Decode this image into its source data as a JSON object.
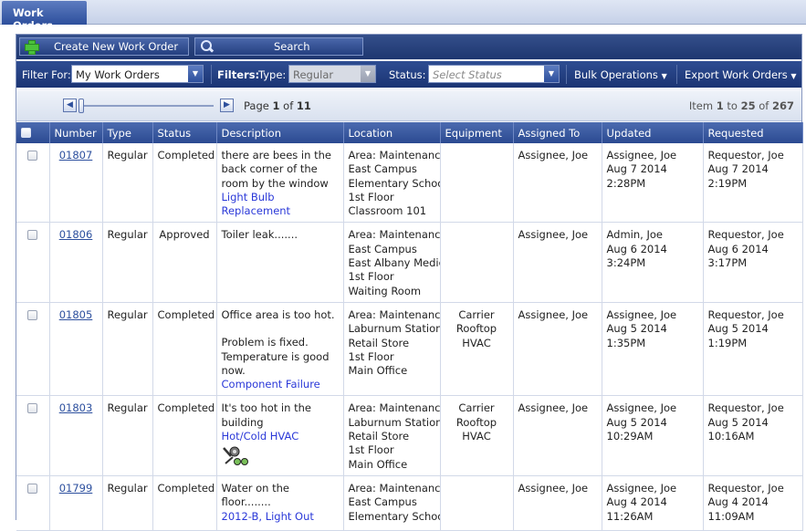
{
  "tab": {
    "label": "Work Orders"
  },
  "toolbar": {
    "create_label": "Create New Work Order",
    "search_label": "Search"
  },
  "filters": {
    "filter_for_label": "Filter For:",
    "filter_for_value": "My Work Orders",
    "filters_label": "Filters:",
    "type_label": "Type:",
    "type_value": "Regular",
    "status_label": "Status:",
    "status_placeholder": "Select Status",
    "bulk_label": "Bulk Operations",
    "export_label": "Export Work Orders"
  },
  "pager": {
    "page_text": "Page",
    "page_current": "1",
    "of_text": "of",
    "page_total": "11",
    "item_text": "Item",
    "item_from": "1",
    "to_text": "to",
    "item_to": "25",
    "of2_text": "of",
    "item_total": "267"
  },
  "columns": [
    "Number",
    "Type",
    "Status",
    "Description",
    "Location",
    "Equipment",
    "Assigned To",
    "Updated",
    "Requested"
  ],
  "rows": [
    {
      "number": "01807",
      "type": "Regular",
      "status": "Completed",
      "description": "there are bees in the back corner of the room by the window",
      "category": "Light Bulb Replacement",
      "location": [
        "Area: Maintenance",
        "East Campus",
        "Elementary School",
        "1st Floor",
        "Classroom 101"
      ],
      "equipment": [],
      "assigned": "Assignee, Joe",
      "updated": [
        "Assignee, Joe",
        "Aug 7 2014",
        "2:28PM"
      ],
      "requested": [
        "Requestor, Joe",
        "Aug 7 2014",
        "2:19PM"
      ]
    },
    {
      "number": "01806",
      "type": "Regular",
      "status": "Approved",
      "description": "Toiler leak.......",
      "category": "",
      "location": [
        "Area: Maintenance",
        "East Campus",
        "East Albany Medical",
        "1st Floor",
        "Waiting Room"
      ],
      "equipment": [],
      "assigned": "Assignee, Joe",
      "updated": [
        "Admin, Joe",
        "Aug 6 2014",
        "3:24PM"
      ],
      "requested": [
        "Requestor, Joe",
        "Aug 6 2014",
        "3:17PM"
      ]
    },
    {
      "number": "01805",
      "type": "Regular",
      "status": "Completed",
      "description": "Office area is too hot.",
      "description2": "Problem is fixed.",
      "description3": " Temperature is good now.",
      "category": "Component Failure",
      "location": [
        "Area: Maintenance",
        "Laburnum Station",
        "Retail Store",
        "1st Floor",
        "Main Office"
      ],
      "equipment": [
        "Carrier",
        "Rooftop",
        "HVAC"
      ],
      "assigned": "Assignee, Joe",
      "updated": [
        "Assignee, Joe",
        "Aug 5 2014",
        "1:35PM"
      ],
      "requested": [
        "Requestor, Joe",
        "Aug 5 2014",
        "1:19PM"
      ]
    },
    {
      "number": "01803",
      "type": "Regular",
      "status": "Completed",
      "description": "It's too hot in the building",
      "category": "Hot/Cold HVAC",
      "icon": "tools-icon",
      "location": [
        "Area: Maintenance",
        "Laburnum Station",
        "Retail Store",
        "1st Floor",
        "Main Office"
      ],
      "equipment": [
        "Carrier",
        "Rooftop",
        "HVAC"
      ],
      "assigned": "Assignee, Joe",
      "updated": [
        "Assignee, Joe",
        "Aug 5 2014",
        "10:29AM"
      ],
      "requested": [
        "Requestor, Joe",
        "Aug 5 2014",
        "10:16AM"
      ]
    },
    {
      "number": "01799",
      "type": "Regular",
      "status": "Completed",
      "description": "Water on the floor........",
      "category": "2012-B, Light Out",
      "location": [
        "Area: Maintenance",
        "East Campus",
        "Elementary School"
      ],
      "equipment": [],
      "assigned": "Assignee, Joe",
      "updated": [
        "Assignee, Joe",
        "Aug 4 2014",
        "11:26AM"
      ],
      "requested": [
        "Requestor, Joe",
        "Aug 4 2014",
        "11:09AM"
      ]
    }
  ]
}
